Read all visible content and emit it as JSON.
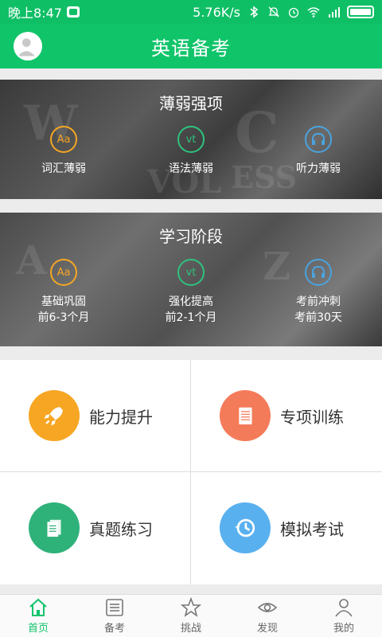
{
  "status": {
    "time": "晚上8:47",
    "speed": "5.76K/s"
  },
  "app": {
    "title": "英语备考"
  },
  "weak": {
    "title": "薄弱强项",
    "items": [
      {
        "icon_text": "Aa",
        "label": "词汇薄弱"
      },
      {
        "icon_text": "vt",
        "label": "语法薄弱"
      },
      {
        "icon": "headphones-icon",
        "label": "听力薄弱"
      }
    ]
  },
  "stage": {
    "title": "学习阶段",
    "items": [
      {
        "icon_text": "Aa",
        "label": "基础巩固",
        "sub": "前6-3个月"
      },
      {
        "icon_text": "vt",
        "label": "强化提高",
        "sub": "前2-1个月"
      },
      {
        "icon": "headphones-icon",
        "label": "考前冲刺",
        "sub": "考前30天"
      }
    ]
  },
  "grid": [
    {
      "label": "能力提升",
      "icon": "rocket-icon",
      "color": "#f6a623"
    },
    {
      "label": "专项训练",
      "icon": "list-icon",
      "color": "#f47b5a"
    },
    {
      "label": "真题练习",
      "icon": "papers-icon",
      "color": "#2fb27a"
    },
    {
      "label": "模拟考试",
      "icon": "clock-history-icon",
      "color": "#59b0ef"
    }
  ],
  "nav": [
    {
      "label": "首页",
      "icon": "home-icon",
      "active": true
    },
    {
      "label": "备考",
      "icon": "list-icon"
    },
    {
      "label": "挑战",
      "icon": "star-icon"
    },
    {
      "label": "发现",
      "icon": "eye-icon"
    },
    {
      "label": "我的",
      "icon": "user-icon"
    }
  ],
  "colors": {
    "brand": "#10c46a",
    "active_nav": "#10c46a"
  }
}
